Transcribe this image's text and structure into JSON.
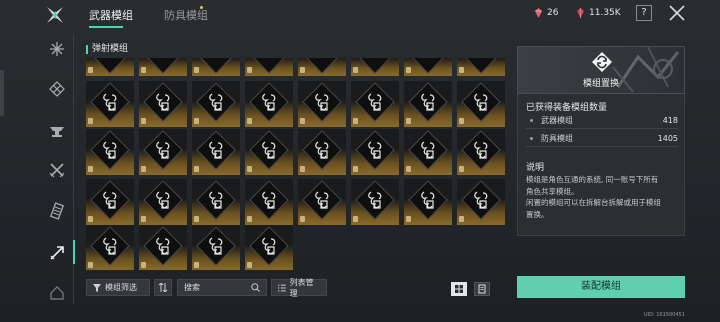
{
  "tabs": [
    {
      "label": "武器模组",
      "active": true
    },
    {
      "label": "防具模组",
      "active": false
    }
  ],
  "currency": [
    {
      "icon": "gem-icon",
      "value": "26"
    },
    {
      "icon": "crystal-icon",
      "value": "11.35K"
    }
  ],
  "help_label": "?",
  "rail": {
    "icons": [
      "snowflake-icon",
      "ornament-icon",
      "anvil-icon",
      "swords-icon",
      "cartridge-icon",
      "arrow-icon",
      "home-icon"
    ],
    "active_index": 5
  },
  "grid": {
    "title": "弹射模组",
    "rows": [
      8,
      8,
      8,
      8,
      4
    ],
    "first_row_clipped": true
  },
  "toolbar": {
    "filter_label": "模组筛选",
    "search_placeholder": "搜索",
    "list_label": "列表管理"
  },
  "panel": {
    "header_title": "模组置换",
    "owned_title": "已获得装备模组数量",
    "stats": [
      {
        "label": "武器模组",
        "value": "418"
      },
      {
        "label": "防具模组",
        "value": "1405"
      }
    ],
    "desc_title": "说明",
    "desc_lines": [
      "模组是角色互通的系统, 同一账号下所有",
      "角色共享模组。",
      "闲置的模组可以在拆解台拆解或用于模组",
      "置换。"
    ],
    "equip_label": "装配模组"
  },
  "uid": "UID: 161500451",
  "colors": {
    "accent": "#49d6b8",
    "button": "#5fcfae",
    "gold": "#8a6a2a"
  }
}
